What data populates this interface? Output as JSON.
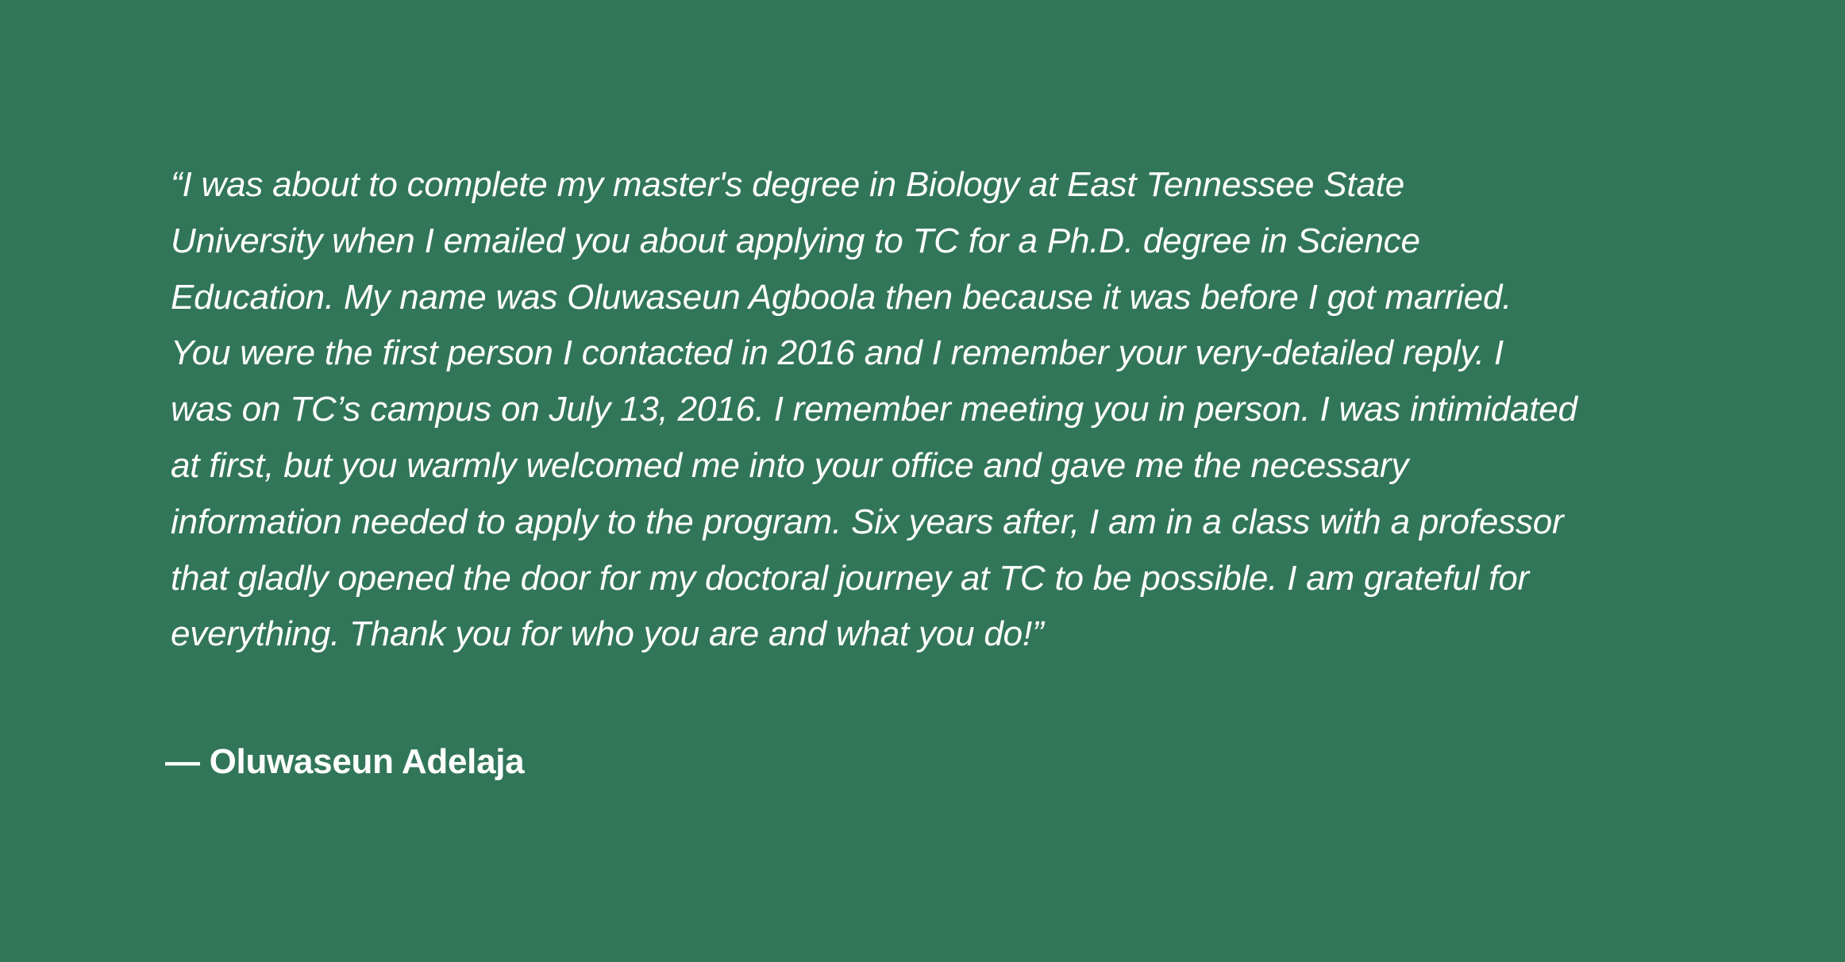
{
  "testimonial": {
    "quote_lines": [
      "“I was about to complete my master's degree in Biology at East Tennessee State",
      "University when I emailed you about applying to TC for a Ph.D. degree in Science",
      "Education. My name was Oluwaseun Agboola then because it was before I got married.",
      "You were the first person I contacted in 2016 and I remember your very-detailed reply. I",
      "was on TC’s campus on July 13, 2016. I remember meeting you in person. I was intimidated",
      "at first, but you warmly welcomed me into your office and gave me the necessary",
      "information needed to apply to the program. Six years after, I am in a class with a professor",
      "that gladly opened the door for my doctoral journey at TC to be possible. I am grateful for",
      "everything. Thank you for who you are and what you do!”"
    ],
    "attribution": "— Oluwaseun Adelaja"
  },
  "colors": {
    "background": "#32765a",
    "text": "#ffffff"
  }
}
